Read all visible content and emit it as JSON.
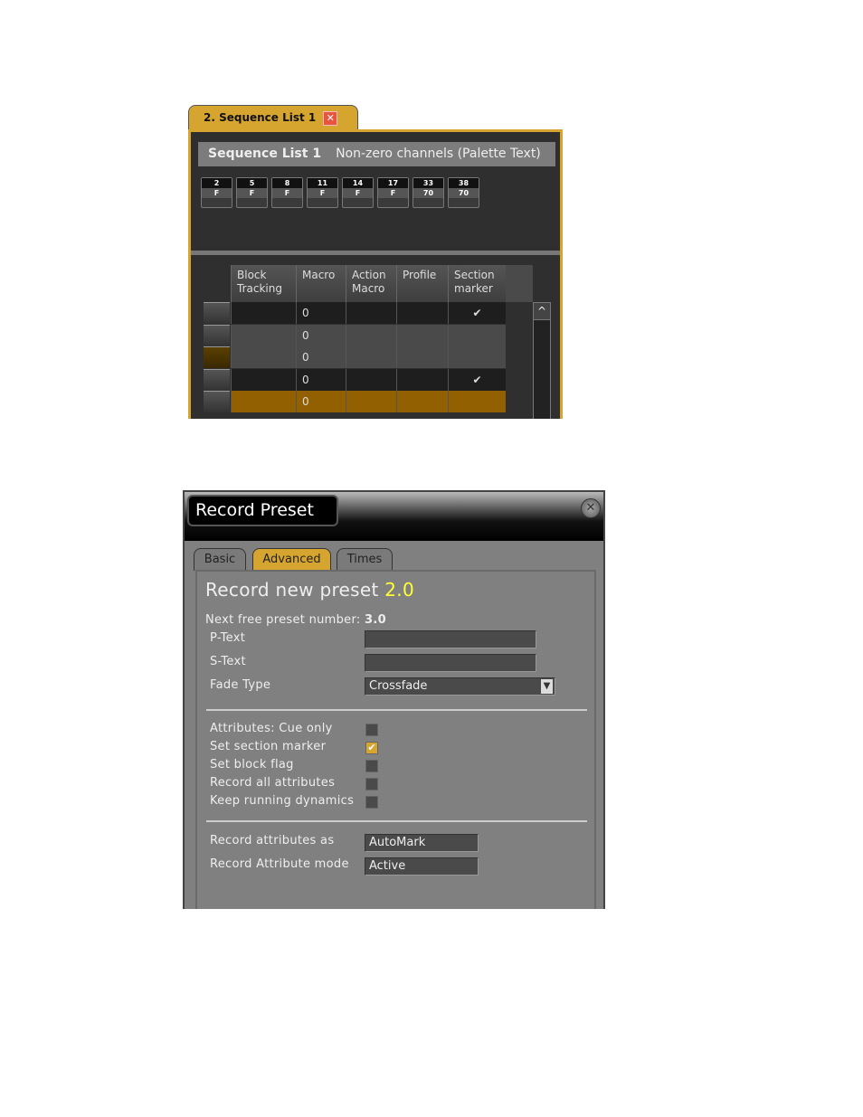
{
  "sequence_window": {
    "tab_label": "2. Sequence List 1",
    "title": "Sequence List 1",
    "subtitle": "Non-zero channels (Palette Text)",
    "channels": [
      {
        "num": "2",
        "val": "F"
      },
      {
        "num": "5",
        "val": "F"
      },
      {
        "num": "8",
        "val": "F"
      },
      {
        "num": "11",
        "val": "F"
      },
      {
        "num": "14",
        "val": "F"
      },
      {
        "num": "17",
        "val": "F"
      },
      {
        "num": "33",
        "val": "70"
      },
      {
        "num": "38",
        "val": "70"
      }
    ],
    "columns": [
      "Block Tracking",
      "Macro",
      "Action Macro",
      "Profile",
      "Section marker"
    ],
    "rows": [
      {
        "block": "",
        "macro": "0",
        "action": "",
        "profile": "",
        "section": "✔",
        "style": "dark"
      },
      {
        "block": "",
        "macro": "0",
        "action": "",
        "profile": "",
        "section": "",
        "style": "mid"
      },
      {
        "block": "",
        "macro": "0",
        "action": "",
        "profile": "",
        "section": "",
        "style": "mid"
      },
      {
        "block": "",
        "macro": "0",
        "action": "",
        "profile": "",
        "section": "✔",
        "style": "dark"
      },
      {
        "block": "",
        "macro": "0",
        "action": "",
        "profile": "",
        "section": "",
        "style": "selected"
      }
    ],
    "scroll_up": "^",
    "accent": "#d6a530"
  },
  "record_preset": {
    "title": "Record Preset",
    "tabs": [
      "Basic",
      "Advanced",
      "Times"
    ],
    "active_tab": "Advanced",
    "heading": "Record new preset",
    "preset_number": "2.0",
    "next_free_label": "Next free preset number:",
    "next_free_value": "3.0",
    "p_text_label": "P-Text",
    "p_text_value": "",
    "s_text_label": "S-Text",
    "s_text_value": "",
    "fade_type_label": "Fade Type",
    "fade_type_value": "Crossfade",
    "options": [
      {
        "label": "Attributes: Cue only",
        "checked": false
      },
      {
        "label": "Set section marker",
        "checked": true
      },
      {
        "label": "Set block flag",
        "checked": false
      },
      {
        "label": "Record all attributes",
        "checked": false
      },
      {
        "label": "Keep running dynamics",
        "checked": false
      }
    ],
    "record_as_label": "Record attributes as",
    "record_as_value": "AutoMark",
    "record_mode_label": "Record Attribute mode",
    "record_mode_value": "Active",
    "highlight_color": "#ffff33"
  }
}
